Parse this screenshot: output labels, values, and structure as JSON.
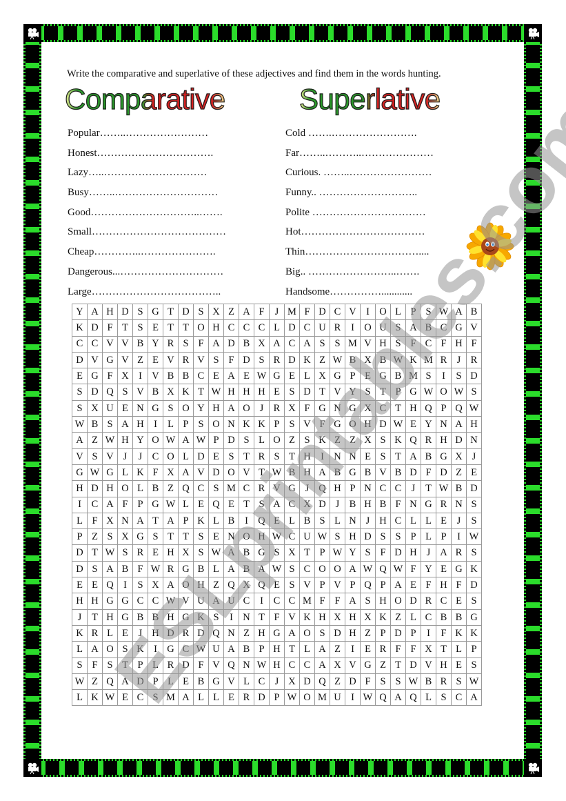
{
  "instructions": "Write the comparative and superlative of these adjectives and find them in the words hunting.",
  "headings": {
    "comparative": "Comparative",
    "superlative": "Superlative"
  },
  "comparative_items": [
    {
      "word": "Popular",
      "blank": "……..……………………"
    },
    {
      "word": "Honest",
      "blank": "……………………………."
    },
    {
      "word": "Lazy",
      "blank": "…..…………………………"
    },
    {
      "word": "Busy",
      "blank": "……..…………………………"
    },
    {
      "word": "Good",
      "blank": "…………………………..……."
    },
    {
      "word": "Small",
      "blank": "…………………………………"
    },
    {
      "word": "Cheap",
      "blank": "…………..…………………."
    },
    {
      "word": "Dangerous",
      "blank": "...…………………………"
    },
    {
      "word": "Large",
      "blank": "……………………………….."
    }
  ],
  "superlative_items": [
    {
      "word": "Cold",
      "blank": "  …….……………………."
    },
    {
      "word": "Far",
      "blank": "……..………..…………………"
    },
    {
      "word": "Curious",
      "blank": ". ……..……………………"
    },
    {
      "word": "Funny",
      "blank": "..  ……………………….."
    },
    {
      "word": "Polite",
      "blank": " ……………………………"
    },
    {
      "word": "Hot",
      "blank": "………………………………"
    },
    {
      "word": "Thin",
      "blank": "……………………………...."
    },
    {
      "word": "Big",
      "blank": ".. ……………………..……."
    },
    {
      "word": "Handsome",
      "blank": "……………............"
    }
  ],
  "grid": [
    "YAHDSGTDSXZAFJMFDCVIOLPSWAB",
    "KDFTSETTOHCCCLDCURIOUSABCGV",
    "CCVVBYRSFADBXACASSMVHSFCFHF",
    "DVGVZEVRVSFDSRDKZWBXBWKMRJR",
    "EGFXIVBBCEAEWGELXGPEGBMSISD",
    "SDQSVBXKTWHHHESDTVYSTPGWOWS",
    "SXUENGSOYHAOJRXFGNGXCTHQPQW",
    "WBSAHILPSONKKPSVFGOHDWEYNAH",
    "AZWHYOWAWPDSLOZSKZZXSKQRHDN",
    "VSVJJCOLDESTRSTHINNESTABGXJ",
    "GWGLKFXAVDOVTWBHABGBVBDFDZE",
    "HDHOLBZQCSMCRVGJQHPNCCJTWBD",
    "ICAFPGWLEQETSACXDJBHBFNGRNS",
    "LFXNATAPKLBIQELBSLNJHCLLEJS",
    "PZSXGSTTSENOHWCUWSHDSSPLPIW",
    "DTWSREHXSWABGSXTPWYSFDHJARS",
    "DSABFWRGBLABAWSCOOAWQWFYEGK",
    "EEQISXAOHZQXQESVPVPQPAEFHFD",
    "HHGGCCWVUAUCICCMFFASHODRCES",
    "JTHGBBHGKSINTFVKHXHXKZLCBBG",
    "KRLEJHDRDQNZHGAOSDHZPDPIFKK",
    "LAOSKIGCWUABPHTLAZIERFFXTLP",
    "SFSTPLRDFVQNWHCCAXVGZTDVHES",
    "WZQADPLEBGVLCJXDQZDFSSWBRSW",
    "LKWECSMALLERDPWOMUIWQAQLSCA"
  ],
  "watermark": "ESLprintables.com",
  "colors": {
    "frame_green": "#2bdc2b",
    "frame_black": "#000000",
    "heading_green": "#2a9a2a",
    "heading_red": "#d82020",
    "heading_yellow": "#f4f09a"
  },
  "decorations": {
    "corner_icon": "movie-camera-icon",
    "flower_icon": "smiling-sunflower-icon"
  }
}
